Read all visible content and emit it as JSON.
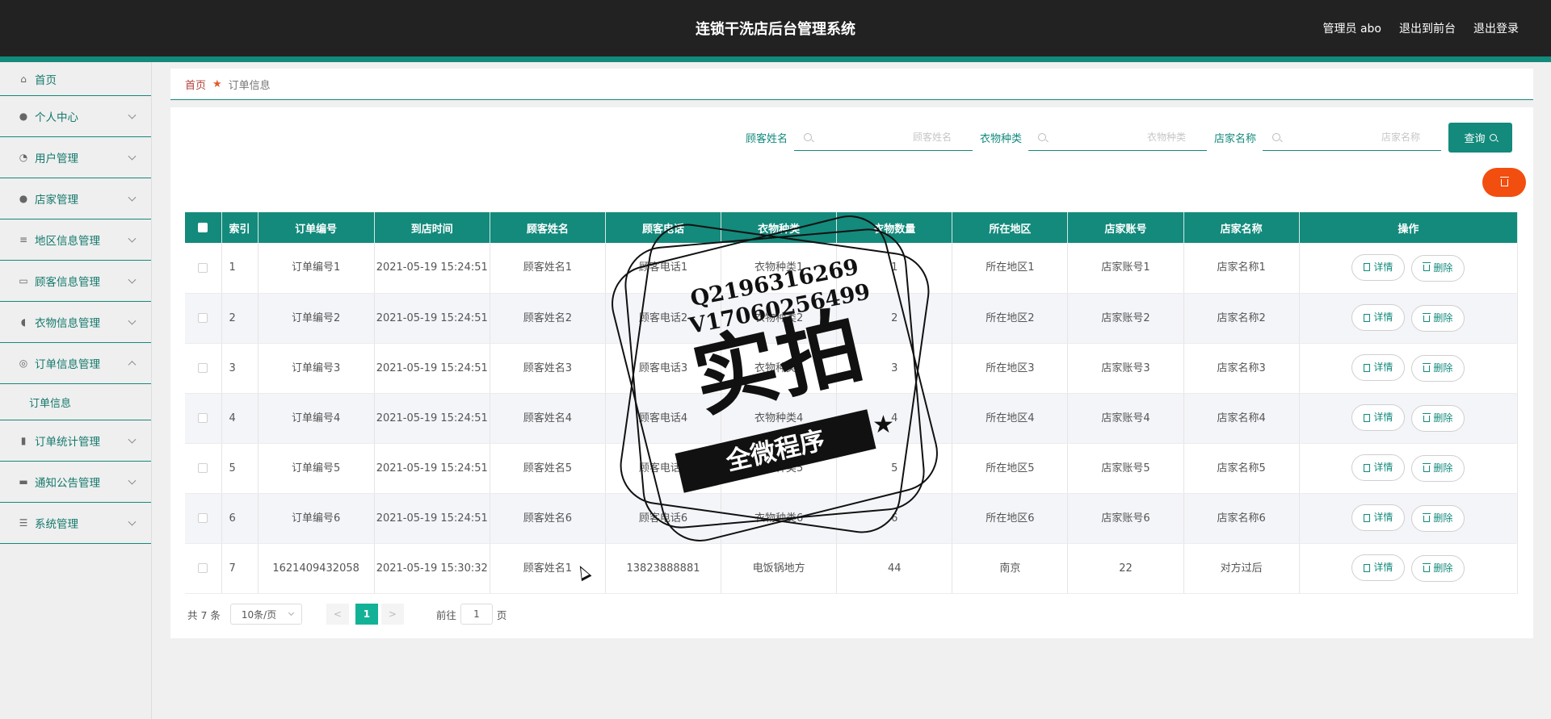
{
  "app": {
    "title": "连锁干洗店后台管理系统"
  },
  "top_links": [
    "管理员 abo",
    "退出到前台",
    "退出登录"
  ],
  "sidebar": {
    "items": [
      {
        "label": "首页",
        "icon": "home-icon",
        "expanded": false,
        "has_chevron": false
      },
      {
        "label": "个人中心",
        "icon": "user-icon",
        "expanded": false,
        "has_chevron": true
      },
      {
        "label": "用户管理",
        "icon": "bell-off-icon",
        "expanded": false,
        "has_chevron": true
      },
      {
        "label": "店家管理",
        "icon": "user-icon",
        "expanded": false,
        "has_chevron": true
      },
      {
        "label": "地区信息管理",
        "icon": "list-icon",
        "expanded": false,
        "has_chevron": true
      },
      {
        "label": "顾客信息管理",
        "icon": "card-icon",
        "expanded": false,
        "has_chevron": true
      },
      {
        "label": "衣物信息管理",
        "icon": "mic-icon",
        "expanded": false,
        "has_chevron": true
      },
      {
        "label": "订单信息管理",
        "icon": "compass-icon",
        "expanded": true,
        "has_chevron": true,
        "submenu": [
          "订单信息"
        ]
      },
      {
        "label": "订单统计管理",
        "icon": "bar-chart-icon",
        "expanded": false,
        "has_chevron": true
      },
      {
        "label": "通知公告管理",
        "icon": "printer-icon",
        "expanded": false,
        "has_chevron": true
      },
      {
        "label": "系统管理",
        "icon": "menu-icon",
        "expanded": false,
        "has_chevron": true
      }
    ]
  },
  "breadcrumb": {
    "home": "首页",
    "current": "订单信息"
  },
  "search": {
    "fields": [
      {
        "label": "顾客姓名",
        "placeholder": "顾客姓名",
        "value": ""
      },
      {
        "label": "衣物种类",
        "placeholder": "衣物种类",
        "value": ""
      },
      {
        "label": "店家名称",
        "placeholder": "店家名称",
        "value": ""
      }
    ],
    "query_label": "查询"
  },
  "table": {
    "columns": [
      "",
      "索引",
      "订单编号",
      "到店时间",
      "顾客姓名",
      "顾客电话",
      "衣物种类",
      "衣物数量",
      "所在地区",
      "店家账号",
      "店家名称",
      "操作"
    ],
    "rows": [
      [
        "1",
        "订单编号1",
        "2021-05-19 15:24:51",
        "顾客姓名1",
        "顾客电话1",
        "衣物种类1",
        "1",
        "所在地区1",
        "店家账号1",
        "店家名称1"
      ],
      [
        "2",
        "订单编号2",
        "2021-05-19 15:24:51",
        "顾客姓名2",
        "顾客电话2",
        "衣物种类2",
        "2",
        "所在地区2",
        "店家账号2",
        "店家名称2"
      ],
      [
        "3",
        "订单编号3",
        "2021-05-19 15:24:51",
        "顾客姓名3",
        "顾客电话3",
        "衣物种类3",
        "3",
        "所在地区3",
        "店家账号3",
        "店家名称3"
      ],
      [
        "4",
        "订单编号4",
        "2021-05-19 15:24:51",
        "顾客姓名4",
        "顾客电话4",
        "衣物种类4",
        "4",
        "所在地区4",
        "店家账号4",
        "店家名称4"
      ],
      [
        "5",
        "订单编号5",
        "2021-05-19 15:24:51",
        "顾客姓名5",
        "顾客电话5",
        "衣物种类5",
        "5",
        "所在地区5",
        "店家账号5",
        "店家名称5"
      ],
      [
        "6",
        "订单编号6",
        "2021-05-19 15:24:51",
        "顾客姓名6",
        "顾客电话6",
        "衣物种类6",
        "6",
        "所在地区6",
        "店家账号6",
        "店家名称6"
      ],
      [
        "7",
        "1621409432058",
        "2021-05-19 15:30:32",
        "顾客姓名1",
        "13823888881",
        "电饭锅地方",
        "44",
        "南京",
        "22",
        "对方过后"
      ]
    ],
    "detail_label": "详情",
    "delete_label": "删除"
  },
  "pagination": {
    "total_text": "共 7 条",
    "page_size": "10条/页",
    "current_page": "1",
    "goto_prefix": "前往",
    "goto_value": "1",
    "goto_suffix": "页"
  },
  "watermark": {
    "contact": "Q2196316269 V17060256499",
    "main_text": "实拍",
    "ribbon_text": "全微程序"
  },
  "colors": {
    "header": "#222222",
    "accent": "#138a7c",
    "danger": "#f24e0f",
    "page_active": "#13b296"
  }
}
